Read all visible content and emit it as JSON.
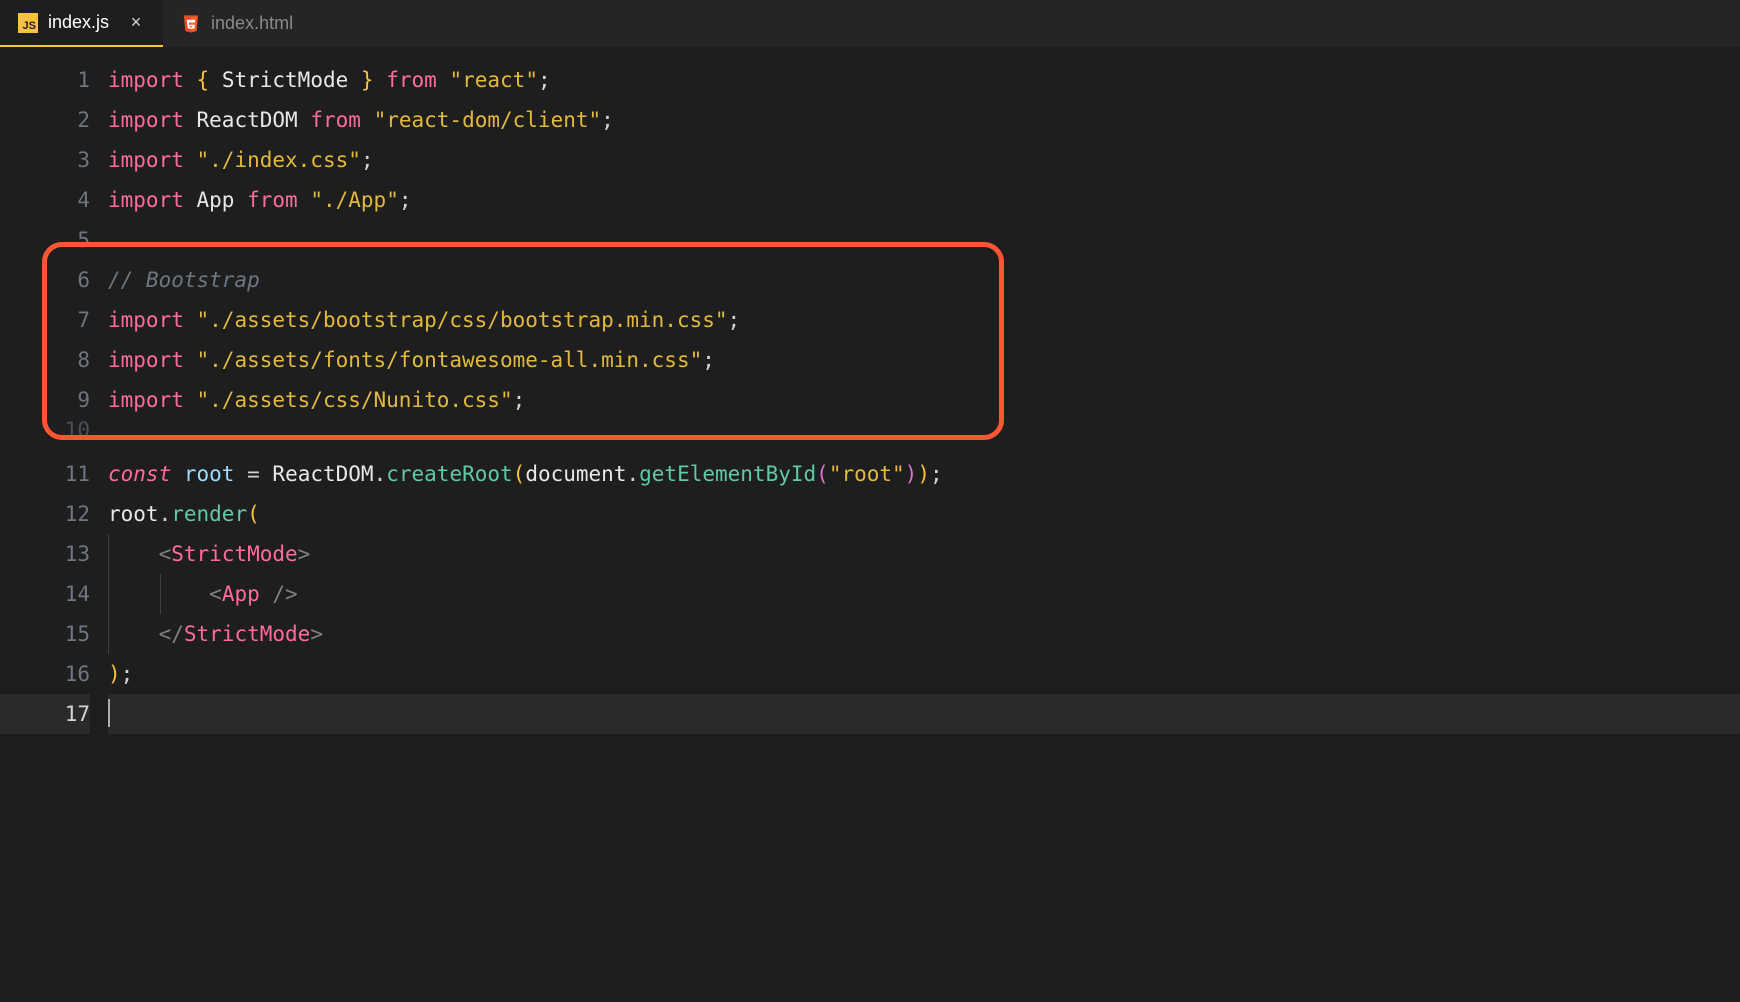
{
  "tabs": [
    {
      "label": "index.js",
      "icon": "js",
      "active": true
    },
    {
      "label": "index.html",
      "icon": "html",
      "active": false
    }
  ],
  "highlight": {
    "startLine": 5,
    "endLine": 10
  },
  "cursorLine": 17,
  "code": {
    "lines": [
      {
        "num": "1",
        "tokens": [
          {
            "t": "import",
            "c": "kw-import"
          },
          {
            "t": " ",
            "c": ""
          },
          {
            "t": "{",
            "c": "brace"
          },
          {
            "t": " ",
            "c": ""
          },
          {
            "t": "StrictMode",
            "c": "ident"
          },
          {
            "t": " ",
            "c": ""
          },
          {
            "t": "}",
            "c": "brace"
          },
          {
            "t": " ",
            "c": ""
          },
          {
            "t": "from",
            "c": "kw-from"
          },
          {
            "t": " ",
            "c": ""
          },
          {
            "t": "\"react\"",
            "c": "string"
          },
          {
            "t": ";",
            "c": "punct"
          }
        ]
      },
      {
        "num": "2",
        "tokens": [
          {
            "t": "import",
            "c": "kw-import"
          },
          {
            "t": " ",
            "c": ""
          },
          {
            "t": "ReactDOM",
            "c": "ident"
          },
          {
            "t": " ",
            "c": ""
          },
          {
            "t": "from",
            "c": "kw-from"
          },
          {
            "t": " ",
            "c": ""
          },
          {
            "t": "\"react-dom/client\"",
            "c": "string"
          },
          {
            "t": ";",
            "c": "punct"
          }
        ]
      },
      {
        "num": "3",
        "tokens": [
          {
            "t": "import",
            "c": "kw-import"
          },
          {
            "t": " ",
            "c": ""
          },
          {
            "t": "\"./index.css\"",
            "c": "string"
          },
          {
            "t": ";",
            "c": "punct"
          }
        ]
      },
      {
        "num": "4",
        "tokens": [
          {
            "t": "import",
            "c": "kw-import"
          },
          {
            "t": " ",
            "c": ""
          },
          {
            "t": "App",
            "c": "ident"
          },
          {
            "t": " ",
            "c": ""
          },
          {
            "t": "from",
            "c": "kw-from"
          },
          {
            "t": " ",
            "c": ""
          },
          {
            "t": "\"./App\"",
            "c": "string"
          },
          {
            "t": ";",
            "c": "punct"
          }
        ]
      },
      {
        "num": "5",
        "tokens": []
      },
      {
        "num": "6",
        "tokens": [
          {
            "t": "// Bootstrap",
            "c": "comment"
          }
        ]
      },
      {
        "num": "7",
        "tokens": [
          {
            "t": "import",
            "c": "kw-import"
          },
          {
            "t": " ",
            "c": ""
          },
          {
            "t": "\"./assets/bootstrap/css/bootstrap.min.css\"",
            "c": "string"
          },
          {
            "t": ";",
            "c": "punct"
          }
        ]
      },
      {
        "num": "8",
        "tokens": [
          {
            "t": "import",
            "c": "kw-import"
          },
          {
            "t": " ",
            "c": ""
          },
          {
            "t": "\"./assets/fonts/fontawesome-all.min.css\"",
            "c": "string"
          },
          {
            "t": ";",
            "c": "punct"
          }
        ]
      },
      {
        "num": "9",
        "tokens": [
          {
            "t": "import",
            "c": "kw-import"
          },
          {
            "t": " ",
            "c": ""
          },
          {
            "t": "\"./assets/css/Nunito.css\"",
            "c": "string"
          },
          {
            "t": ";",
            "c": "punct"
          }
        ]
      },
      {
        "num": "11",
        "tokens": [
          {
            "t": "const",
            "c": "kw-const"
          },
          {
            "t": " ",
            "c": ""
          },
          {
            "t": "root",
            "c": "prop"
          },
          {
            "t": " ",
            "c": ""
          },
          {
            "t": "=",
            "c": "op"
          },
          {
            "t": " ",
            "c": ""
          },
          {
            "t": "ReactDOM",
            "c": "ident"
          },
          {
            "t": ".",
            "c": "punct"
          },
          {
            "t": "createRoot",
            "c": "method"
          },
          {
            "t": "(",
            "c": "paren-y"
          },
          {
            "t": "document",
            "c": "ident"
          },
          {
            "t": ".",
            "c": "punct"
          },
          {
            "t": "getElementById",
            "c": "method"
          },
          {
            "t": "(",
            "c": "paren-p"
          },
          {
            "t": "\"root\"",
            "c": "string"
          },
          {
            "t": ")",
            "c": "paren-p"
          },
          {
            "t": ")",
            "c": "paren-y"
          },
          {
            "t": ";",
            "c": "punct"
          }
        ]
      },
      {
        "num": "12",
        "tokens": [
          {
            "t": "root",
            "c": "ident"
          },
          {
            "t": ".",
            "c": "punct"
          },
          {
            "t": "render",
            "c": "method"
          },
          {
            "t": "(",
            "c": "paren-y"
          }
        ]
      },
      {
        "num": "13",
        "indent": 1,
        "tokens": [
          {
            "t": "    ",
            "c": ""
          },
          {
            "t": "<",
            "c": "tag-bracket"
          },
          {
            "t": "StrictMode",
            "c": "tag-name"
          },
          {
            "t": ">",
            "c": "tag-bracket"
          }
        ]
      },
      {
        "num": "14",
        "indent": 2,
        "tokens": [
          {
            "t": "        ",
            "c": ""
          },
          {
            "t": "<",
            "c": "tag-bracket"
          },
          {
            "t": "App",
            "c": "tag-name"
          },
          {
            "t": " ",
            "c": ""
          },
          {
            "t": "/>",
            "c": "tag-bracket"
          }
        ]
      },
      {
        "num": "15",
        "indent": 1,
        "tokens": [
          {
            "t": "    ",
            "c": ""
          },
          {
            "t": "</",
            "c": "tag-bracket"
          },
          {
            "t": "StrictMode",
            "c": "tag-name"
          },
          {
            "t": ">",
            "c": "tag-bracket"
          }
        ]
      },
      {
        "num": "16",
        "tokens": [
          {
            "t": ")",
            "c": "paren-y"
          },
          {
            "t": ";",
            "c": "punct"
          }
        ]
      },
      {
        "num": "17",
        "current": true,
        "tokens": []
      }
    ],
    "partial_line_num": "10"
  }
}
